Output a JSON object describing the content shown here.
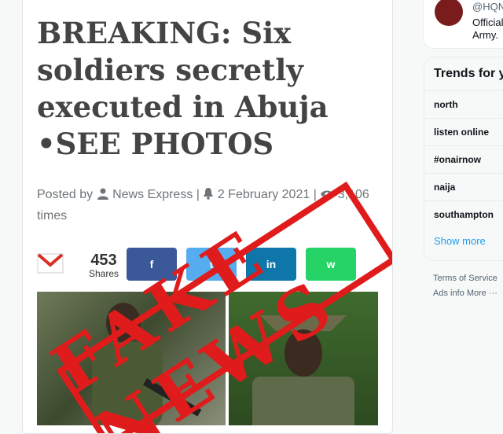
{
  "article": {
    "headline": "BREAKING: Six soldiers secretly executed in Abuja •SEE PHOTOS",
    "posted_by_label": "Posted by",
    "author": "News Express",
    "date": "2 February 2021",
    "views": "3,106",
    "views_suffix": "times",
    "share_count": "453",
    "share_label": "Shares",
    "stamp_text": "FAKE NEWS"
  },
  "share_buttons": [
    {
      "name": "facebook",
      "glyph": "f",
      "color": "#3b5998"
    },
    {
      "name": "twitter",
      "glyph": "t",
      "color": "#55acee"
    },
    {
      "name": "linkedin",
      "glyph": "in",
      "color": "#0e76a8"
    },
    {
      "name": "whatsapp",
      "glyph": "w",
      "color": "#25d366"
    }
  ],
  "profile": {
    "handle": "@HQN",
    "bio": "Official Army."
  },
  "trends": {
    "title": "Trends for you",
    "items": [
      "north",
      "listen online",
      "#onairnow",
      "naija",
      "southampton"
    ],
    "show_more": "Show more"
  },
  "footer": {
    "terms": "Terms of Service",
    "ads": "Ads info",
    "more": "More ···"
  },
  "colors": {
    "stamp": "#e01b1b",
    "link": "#1d9bf0"
  }
}
